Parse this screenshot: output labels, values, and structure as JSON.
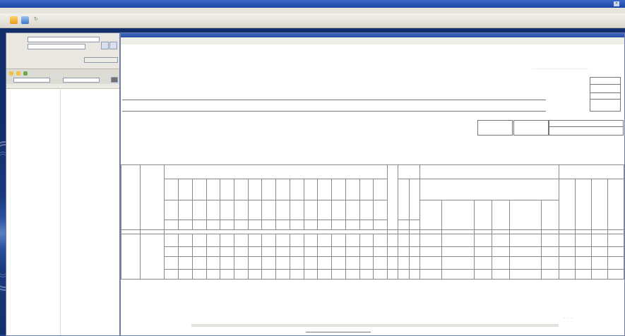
{
  "window": {
    "title": "",
    "menu": [
      "",
      "",
      ""
    ]
  },
  "left_panel": {
    "fields": [
      "",
      ""
    ],
    "grid_headers": [
      "",
      ""
    ],
    "grid_rows": [
      ""
    ]
  },
  "report": {
    "toolbar": [
      ""
    ],
    "title_line1": "",
    "title_line2": "",
    "form_codes": [],
    "header_cells": [],
    "rows": []
  },
  "colors": {
    "desktop": "#1d3f86",
    "titlebar": "#2a56b8",
    "toolbar": "#e6e3da",
    "panel_border": "#6d7ea6"
  },
  "icons": [
    "open-folder-icon",
    "book-icon",
    "refresh-icon",
    "close-icon",
    "filter-icon"
  ]
}
